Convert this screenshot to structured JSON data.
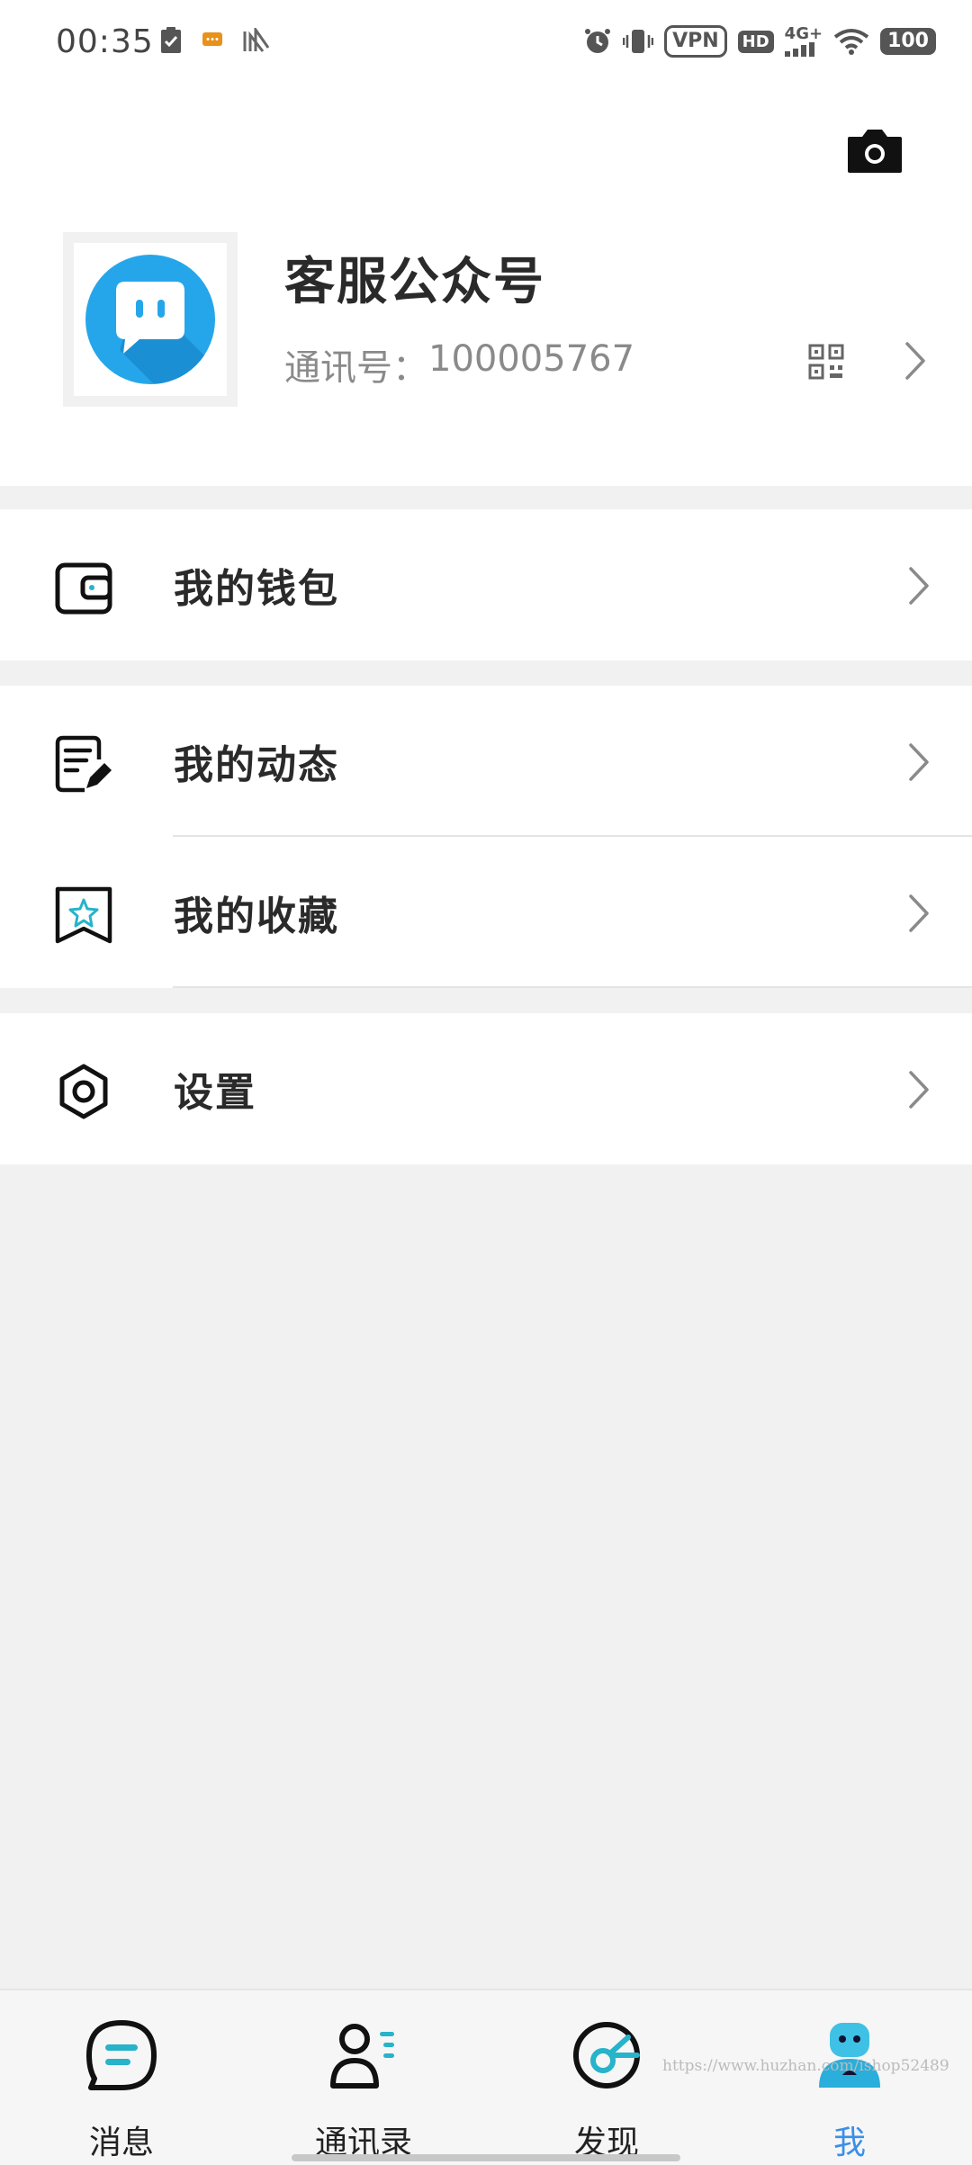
{
  "status_bar": {
    "time": "00:35",
    "vpn": "VPN",
    "hd": "HD",
    "network": "4G+",
    "battery": "100"
  },
  "profile": {
    "name": "客服公众号",
    "id_label": "通讯号：",
    "id_value": "100005767",
    "avatar_color": "#1da1e8"
  },
  "menu": {
    "wallet": "我的钱包",
    "moments": "我的动态",
    "favorites": "我的收藏",
    "settings": "设置"
  },
  "bottom_nav": {
    "items": [
      {
        "label": "消息",
        "icon": "message-icon"
      },
      {
        "label": "通讯录",
        "icon": "contacts-icon"
      },
      {
        "label": "发现",
        "icon": "discover-icon"
      },
      {
        "label": "我",
        "icon": "me-icon",
        "active": true
      }
    ],
    "active_color": "#3b8fe8"
  },
  "watermark": "https://www.huzhan.com/ishop52489"
}
